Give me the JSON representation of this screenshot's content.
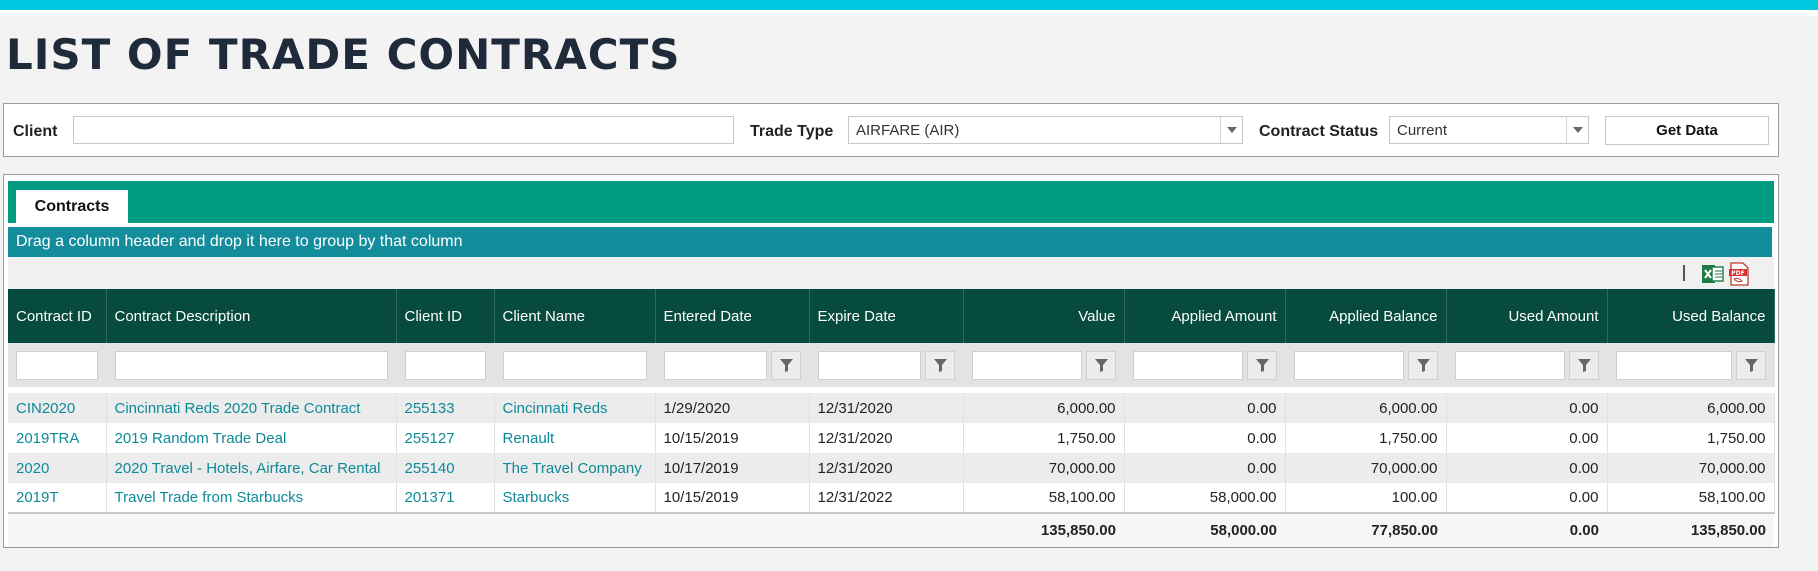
{
  "page": {
    "title": "LIST OF TRADE CONTRACTS"
  },
  "filters": {
    "client_label": "Client",
    "client_value": "",
    "trade_type_label": "Trade Type",
    "trade_type_value": "AIRFARE (AIR)",
    "status_label": "Contract Status",
    "status_value": "Current",
    "get_data_label": "Get Data"
  },
  "grid": {
    "tab_label": "Contracts",
    "group_hint": "Drag a column header and drop it here to group by that column",
    "columns": [
      "Contract ID",
      "Contract Description",
      "Client ID",
      "Client Name",
      "Entered Date",
      "Expire Date",
      "Value",
      "Applied Amount",
      "Applied Balance",
      "Used Amount",
      "Used Balance"
    ],
    "rows": [
      [
        "CIN2020",
        "Cincinnati Reds 2020 Trade Contract",
        "255133",
        "Cincinnati Reds",
        "1/29/2020",
        "12/31/2020",
        "6,000.00",
        "0.00",
        "6,000.00",
        "0.00",
        "6,000.00"
      ],
      [
        "2019TRA",
        "2019 Random Trade Deal",
        "255127",
        "Renault",
        "10/15/2019",
        "12/31/2020",
        "1,750.00",
        "0.00",
        "1,750.00",
        "0.00",
        "1,750.00"
      ],
      [
        "2020",
        "2020 Travel - Hotels, Airfare, Car Rental",
        "255140",
        "The Travel Company",
        "10/17/2019",
        "12/31/2020",
        "70,000.00",
        "0.00",
        "70,000.00",
        "0.00",
        "70,000.00"
      ],
      [
        "2019T",
        "Travel Trade from Starbucks",
        "201371",
        "Starbucks",
        "10/15/2019",
        "12/31/2022",
        "58,100.00",
        "58,000.00",
        "100.00",
        "0.00",
        "58,100.00"
      ]
    ],
    "totals": [
      "135,850.00",
      "58,000.00",
      "77,850.00",
      "0.00",
      "135,850.00"
    ]
  },
  "icons": {
    "excel": "excel-export-icon",
    "pdf": "pdf-export-icon",
    "filter": "filter-funnel-icon",
    "dropdown": "chevron-down-icon"
  },
  "colors": {
    "top_bar": "#00c8e0",
    "tabstrip": "#009b80",
    "group_panel": "#138d9c",
    "header": "#064b3d",
    "link": "#0e8a98"
  }
}
